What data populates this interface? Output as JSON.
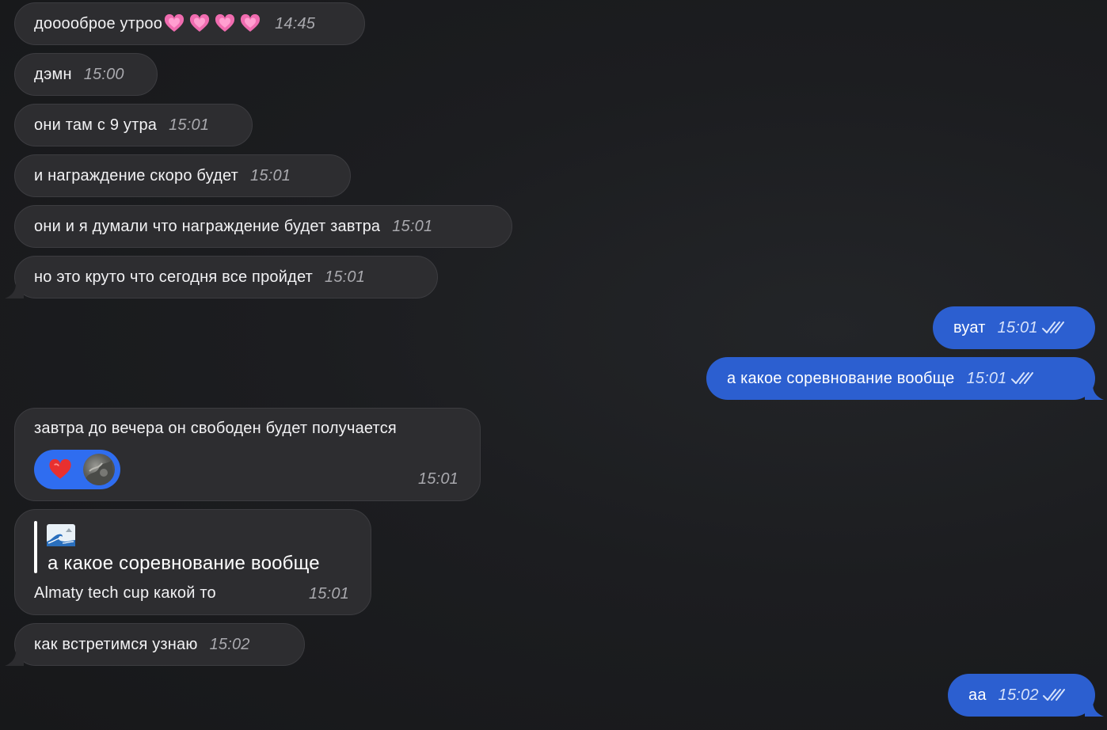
{
  "messages": {
    "m1": {
      "text": "дооооброе утроо",
      "time": "14:45"
    },
    "m2": {
      "text": "дэмн",
      "time": "15:00"
    },
    "m3": {
      "text": "они там с 9 утра",
      "time": "15:01"
    },
    "m4": {
      "text": "и награждение скоро будет",
      "time": "15:01"
    },
    "m5": {
      "text": "они и я думали что награждение будет завтра",
      "time": "15:01"
    },
    "m6": {
      "text": "но это круто что сегодня все пройдет",
      "time": "15:01"
    },
    "m7": {
      "text": "вуат",
      "time": "15:01"
    },
    "m8": {
      "text": "а какое соревнование вообще",
      "time": "15:01"
    },
    "m9": {
      "text": "завтра до вечера он свободен будет получается",
      "time": "15:01",
      "reaction": "heart-reaction-icon"
    },
    "m10": {
      "quote_text": "а какое соревнование вообще",
      "text": "Almaty tech cup какой то",
      "time": "15:01",
      "quote_author_icon": "wave-icon"
    },
    "m11": {
      "text": "как встретимся узнаю",
      "time": "15:02"
    },
    "m12": {
      "text": "аа",
      "time": "15:02"
    }
  },
  "colors": {
    "background": "#1b1c1f",
    "incoming_bubble": "#2d2d30",
    "outgoing_bubble": "#2c5fd0",
    "reaction_pill": "#2f6df0"
  }
}
